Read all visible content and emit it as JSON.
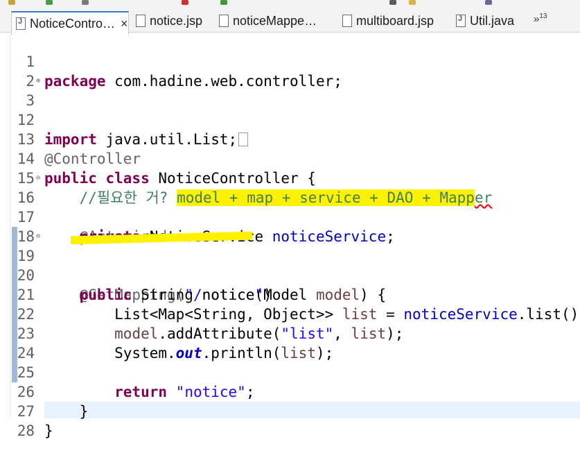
{
  "toolbar": {
    "icons": [
      "build-icon",
      "debug-icon",
      "run-icon",
      "stop-icon",
      "search-icon",
      "open-icon",
      "task-icon",
      "settings-icon"
    ]
  },
  "tabs": [
    {
      "label": "NoticeContro…",
      "close": "×",
      "icon": "java-file-icon",
      "active": true
    },
    {
      "label": "notice.jsp",
      "icon": "jsp-file-icon"
    },
    {
      "label": "noticeMappe…",
      "icon": "xml-file-icon"
    },
    {
      "label": "multiboard.jsp",
      "icon": "jsp-file-icon"
    },
    {
      "label": "Util.java",
      "icon": "java-file-icon"
    }
  ],
  "overflow": {
    "symbol": "»",
    "count": "13"
  },
  "lines": [
    {
      "n": "1",
      "t1": "package",
      "t2": " com.hadine.web.controller;"
    },
    {
      "n": "2"
    },
    {
      "n": "3",
      "t1": "import",
      "t2": " java.util.List;"
    },
    {
      "n": "12"
    },
    {
      "n": "13",
      "t1": "@Controller"
    },
    {
      "n": "14",
      "t1": "public class",
      "t2": " NoticeController {"
    },
    {
      "n": "15",
      "t1": "    //필요한 거? ",
      "t2": "model + map + service + DAO + Mapp",
      "t3": "er"
    },
    {
      "n": "16",
      "t1": "    @Autowired"
    },
    {
      "n": "17",
      "t1": "    private",
      "t2": " NoticeService ",
      "t3": "noticeService",
      "t4": ";"
    },
    {
      "n": "18"
    },
    {
      "n": "19",
      "t1": "    @GetMapping(",
      "t2": "\"/notice\"",
      "t3": ")"
    },
    {
      "n": "20",
      "t1": "    public",
      "t2": " String notice(Model ",
      "t3": "model",
      "t4": ") {"
    },
    {
      "n": "21",
      "t1": "        List<Map<String, Object>> ",
      "t2": "list",
      "t3": " = ",
      "t4": "noticeService",
      "t5": ".list();"
    },
    {
      "n": "22",
      "t1": "        ",
      "t2": "model",
      ".t3": "",
      "t3": ".addAttribute(",
      "t4": "\"list\"",
      "t5": ", ",
      "t6": "list",
      "t7": ");"
    },
    {
      "n": "23",
      "t1": "        System.",
      "t2": "out",
      "t3": ".println(",
      "t4": "list",
      "t5": ");"
    },
    {
      "n": "24"
    },
    {
      "n": "25",
      "t1": "        return",
      "t2": " ",
      "t3": "\"notice\"",
      "t4": ";"
    },
    {
      "n": "26",
      "t1": "    }"
    },
    {
      "n": "27",
      "t1": "}"
    },
    {
      "n": "28"
    }
  ]
}
